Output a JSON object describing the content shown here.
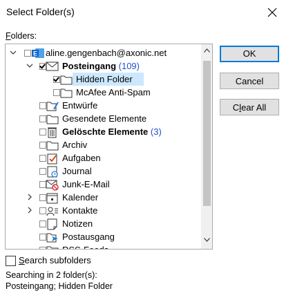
{
  "dialog": {
    "title": "Select Folder(s)"
  },
  "folders_label_accel": "F",
  "folders_label_rest": "olders:",
  "account": "aline.gengenbach@axonic.net",
  "tree": [
    {
      "label": "Posteingang",
      "count": "(109)",
      "bold": true,
      "checked": true,
      "expanded": true,
      "level": 1,
      "icon": "inbox-envelope-icon"
    },
    {
      "label": "Hidden Folder",
      "count": "",
      "bold": false,
      "checked": true,
      "selected": true,
      "level": 2,
      "icon": "folder-icon"
    },
    {
      "label": "McAfee Anti-Spam",
      "count": "",
      "bold": false,
      "checked": false,
      "level": 2,
      "icon": "folder-icon"
    },
    {
      "label": "Entwürfe",
      "count": "",
      "bold": false,
      "checked": false,
      "level": 1,
      "icon": "drafts-icon"
    },
    {
      "label": "Gesendete Elemente",
      "count": "",
      "bold": false,
      "checked": false,
      "level": 1,
      "icon": "folder-icon"
    },
    {
      "label": "Gelöschte Elemente",
      "count": "(3)",
      "bold": true,
      "checked": false,
      "level": 1,
      "icon": "trash-icon"
    },
    {
      "label": "Archiv",
      "count": "",
      "bold": false,
      "checked": false,
      "level": 1,
      "icon": "folder-icon"
    },
    {
      "label": "Aufgaben",
      "count": "",
      "bold": false,
      "checked": false,
      "level": 1,
      "icon": "tasks-icon"
    },
    {
      "label": "Journal",
      "count": "",
      "bold": false,
      "checked": false,
      "level": 1,
      "icon": "journal-icon"
    },
    {
      "label": "Junk-E-Mail",
      "count": "",
      "bold": false,
      "checked": false,
      "level": 1,
      "icon": "junk-mail-icon"
    },
    {
      "label": "Kalender",
      "count": "",
      "bold": false,
      "checked": false,
      "level": 1,
      "icon": "calendar-icon",
      "collapsed": true
    },
    {
      "label": "Kontakte",
      "count": "",
      "bold": false,
      "checked": false,
      "level": 1,
      "icon": "contacts-icon",
      "collapsed": true
    },
    {
      "label": "Notizen",
      "count": "",
      "bold": false,
      "checked": false,
      "level": 1,
      "icon": "notes-icon"
    },
    {
      "label": "Postausgang",
      "count": "",
      "bold": false,
      "checked": false,
      "level": 1,
      "icon": "outbox-icon"
    },
    {
      "label": "RSS-Feeds",
      "count": "",
      "bold": false,
      "checked": false,
      "level": 1,
      "icon": "rss-icon"
    }
  ],
  "buttons": {
    "ok": "OK",
    "cancel": "Cancel",
    "clear_all_accel": "l",
    "clear_all_pre": "C",
    "clear_all_post": "ear All"
  },
  "search_subfolders": {
    "accel": "S",
    "rest": "earch subfolders",
    "checked": false
  },
  "status": {
    "line1": "Searching in 2 folder(s):",
    "line2": "Posteingang; Hidden Folder"
  },
  "colors": {
    "accent": "#0078d7",
    "selection": "#cce8ff",
    "count": "#1e50d2"
  }
}
